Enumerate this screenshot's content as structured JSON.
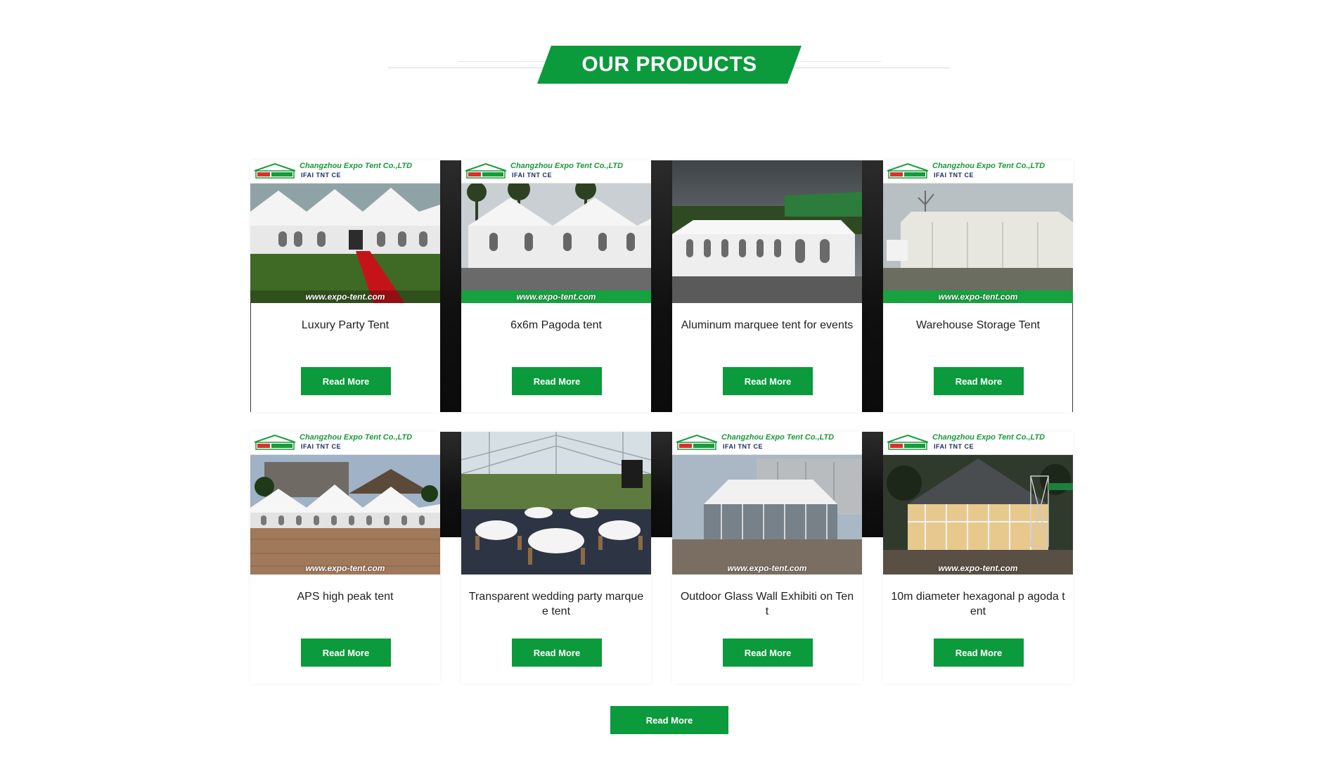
{
  "section": {
    "title": "OUR PRODUCTS",
    "accent_color": "#0b9a3c"
  },
  "brand": {
    "company": "Changzhou Expo Tent Co.,LTD",
    "badges": "IFAI  TNT  CE",
    "url": "www.expo-tent.com"
  },
  "products": [
    {
      "title": "Luxury Party Tent",
      "button": "Read More",
      "url_bar": "green-none"
    },
    {
      "title": "6x6m Pagoda tent",
      "button": "Read More",
      "url_bar": "green"
    },
    {
      "title": "Aluminum marquee tent for events",
      "button": "Read More",
      "url_bar": "none"
    },
    {
      "title": "Warehouse Storage Tent",
      "button": "Read More",
      "url_bar": "green"
    },
    {
      "title": "APS high peak tent",
      "button": "Read More",
      "url_bar": "clear"
    },
    {
      "title": "Transparent wedding party marquee tent",
      "button": "Read More",
      "url_bar": "none"
    },
    {
      "title": "Outdoor Glass Wall Exhibiti on Tent",
      "button": "Read More",
      "url_bar": "clear"
    },
    {
      "title": "10m diameter hexagonal p agoda tent",
      "button": "Read More",
      "url_bar": "clear"
    }
  ],
  "more_button": "Read More"
}
